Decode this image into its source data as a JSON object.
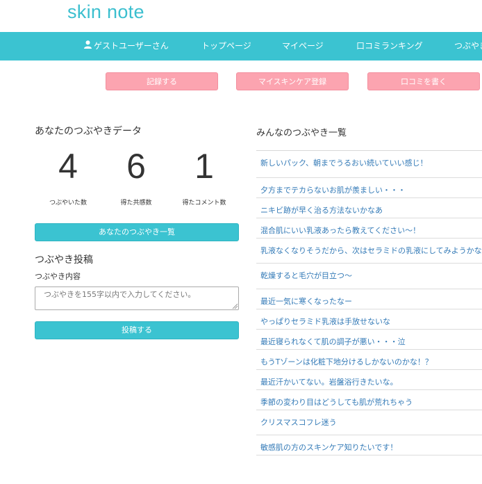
{
  "brand": "skin note",
  "nav": {
    "user": "ゲストユーザーさん",
    "items": [
      "トップページ",
      "マイページ",
      "口コミランキング",
      "つぶやき"
    ]
  },
  "actions": [
    "記録する",
    "マイスキンケア登録",
    "口コミを書く"
  ],
  "stats": {
    "title": "あなたのつぶやきデータ",
    "items": [
      {
        "value": "4",
        "label": "つぶやいた数"
      },
      {
        "value": "6",
        "label": "得た共感数"
      },
      {
        "value": "1",
        "label": "得たコメント数"
      }
    ]
  },
  "list_button": "あなたのつぶやき一覧",
  "post": {
    "title": "つぶやき投稿",
    "label": "つぶやき内容",
    "placeholder": "つぶやきを155字以内で入力してください。",
    "submit": "投稿する"
  },
  "feed": {
    "title": "みんなのつぶやき一覧",
    "items": [
      "新しいパック、朝までうるおい続いていい感じ！",
      "夕方までテカらないお肌が羨ましい・・・",
      "ニキビ跡が早く治る方法ないかなあ",
      "混合肌にいい乳液あったら教えてください〜！",
      "乳液なくなりそうだから、次はセラミドの乳液にしてみようかな",
      "乾燥すると毛穴が目立つ〜",
      "最近一気に寒くなったなー",
      "やっぱりセラミド乳液は手放せないな",
      "最近寝られなくて肌の調子が悪い・・・泣",
      "もうTゾーンは化粧下地分けるしかないのかな！？",
      "最近汗かいてない。岩盤浴行きたいな。",
      "季節の変わり目はどうしても肌が荒れちゃう",
      "クリスマスコフレ迷う",
      "敏感肌の方のスキンケア知りたいです！"
    ]
  },
  "colors": {
    "accent": "#3bc3d1",
    "button_pink": "#fca4b0",
    "link": "#337ab7"
  }
}
